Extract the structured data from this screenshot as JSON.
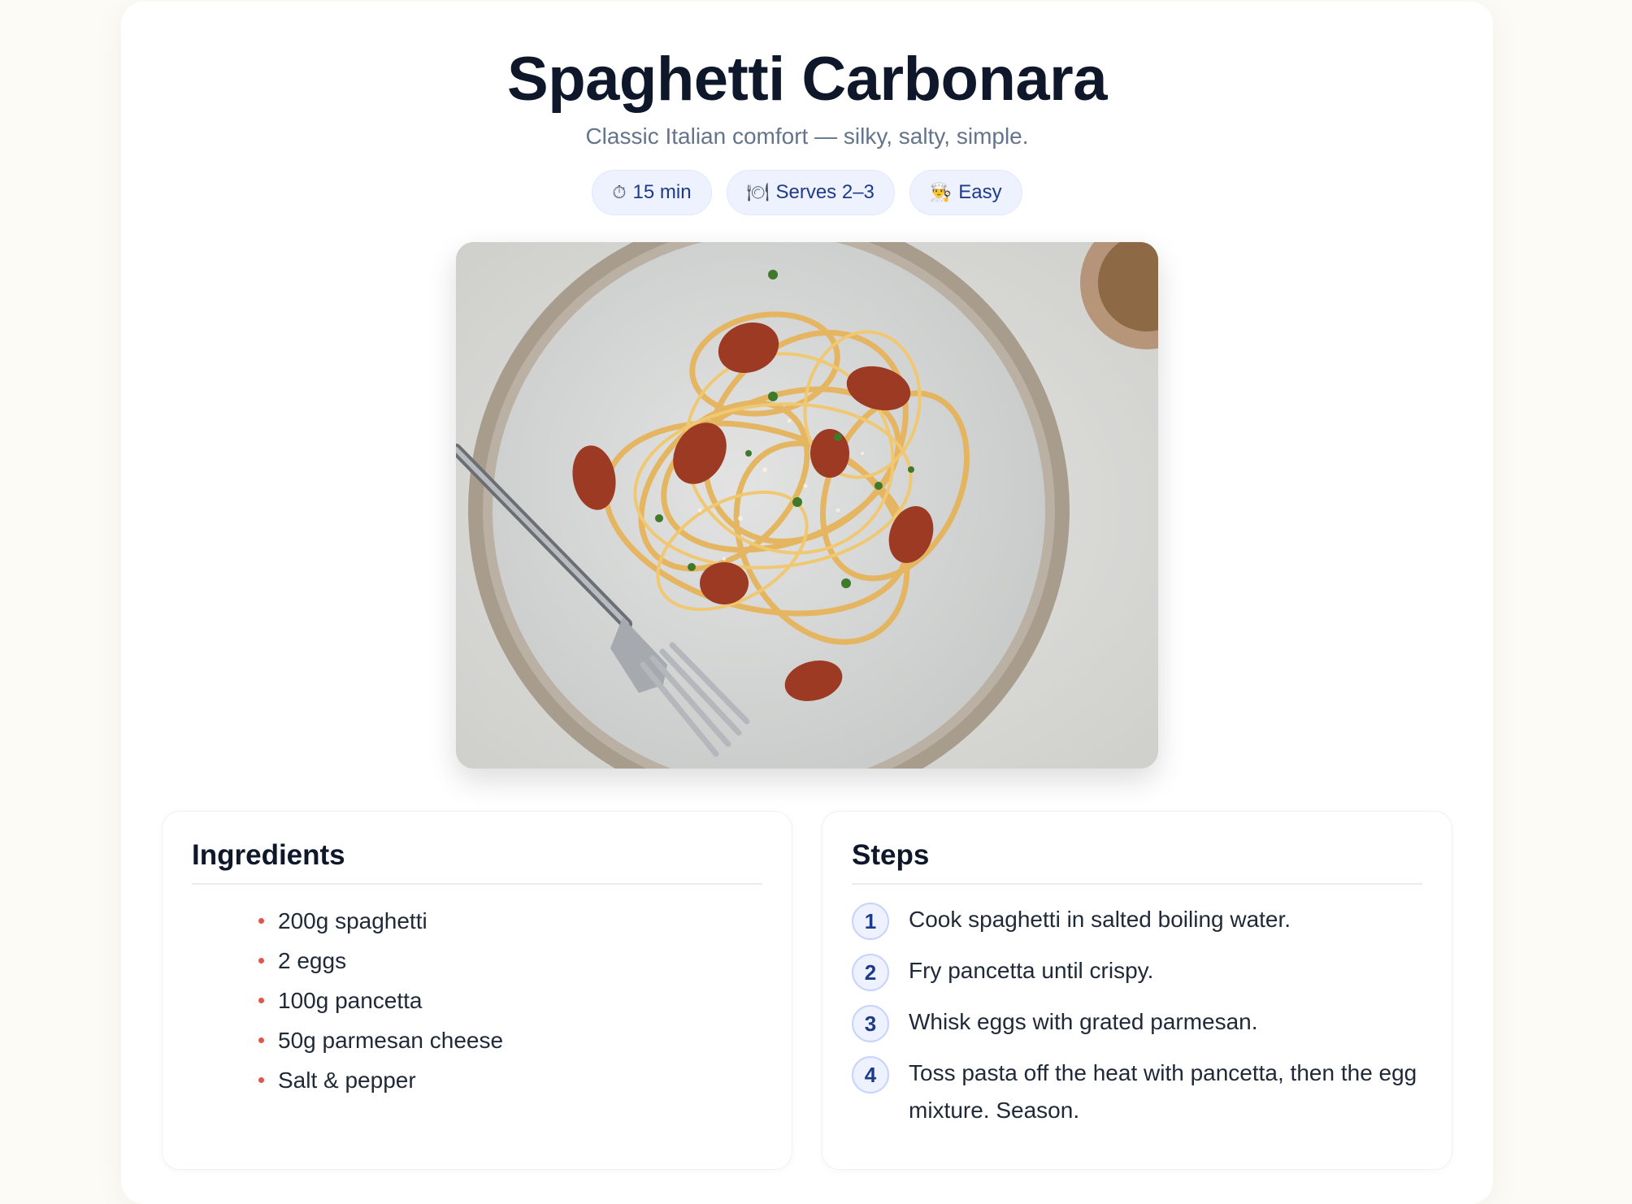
{
  "recipe": {
    "title": "Spaghetti Carbonara",
    "subtitle": "Classic Italian comfort — silky, salty, simple.",
    "badges": [
      {
        "icon": "stopwatch-icon",
        "glyph": "⏱",
        "label": "15 min"
      },
      {
        "icon": "plate-icon",
        "glyph": "🍽",
        "label": "Serves 2–3"
      },
      {
        "icon": "chef-icon",
        "glyph": "👨‍🍳",
        "label": "Easy"
      }
    ],
    "photo_alt": "Plate of spaghetti carbonara with pancetta and parsley"
  },
  "ingredients": {
    "heading": "Ingredients",
    "items": [
      "200g spaghetti",
      "2 eggs",
      "100g pancetta",
      "50g parmesan cheese",
      "Salt & pepper"
    ]
  },
  "steps": {
    "heading": "Steps",
    "items": [
      {
        "n": "1",
        "text": "Cook spaghetti in salted boiling water."
      },
      {
        "n": "2",
        "text": "Fry pancetta until crispy."
      },
      {
        "n": "3",
        "text": "Whisk eggs with grated parmesan."
      },
      {
        "n": "4",
        "text": "Toss pasta off the heat with pancetta, then the egg mixture. Season."
      }
    ]
  },
  "colors": {
    "accent": "#1e3a8a",
    "bullet": "#e2554a",
    "badge_bg": "#eef2ff"
  }
}
